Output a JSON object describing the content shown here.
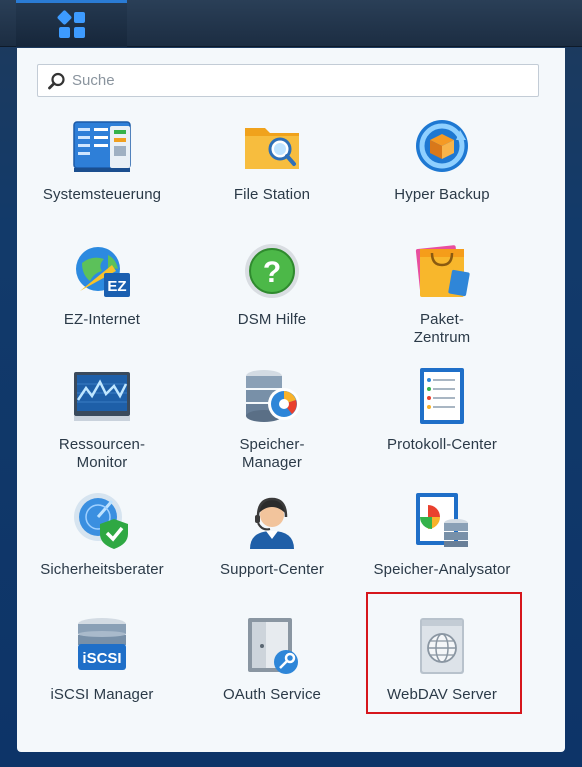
{
  "search": {
    "placeholder": "Suche"
  },
  "apps": [
    {
      "label": "Systemsteuerung",
      "icon": "control-panel-icon"
    },
    {
      "label": "File Station",
      "icon": "folder-search-icon"
    },
    {
      "label": "Hyper Backup",
      "icon": "hyper-backup-icon"
    },
    {
      "label": "EZ-Internet",
      "icon": "globe-ez-icon"
    },
    {
      "label": "DSM Hilfe",
      "icon": "help-icon"
    },
    {
      "label": "Paket-\nZentrum",
      "icon": "package-bag-icon"
    },
    {
      "label": "Ressourcen-\nMonitor",
      "icon": "monitor-graph-icon"
    },
    {
      "label": "Speicher-\nManager",
      "icon": "storage-manager-icon"
    },
    {
      "label": "Protokoll-Center",
      "icon": "log-center-icon"
    },
    {
      "label": "Sicherheitsberater",
      "icon": "security-shield-icon"
    },
    {
      "label": "Support-Center",
      "icon": "support-agent-icon"
    },
    {
      "label": "Speicher-Analysator",
      "icon": "storage-analyzer-icon"
    },
    {
      "label": "iSCSI Manager",
      "icon": "iscsi-icon"
    },
    {
      "label": "OAuth Service",
      "icon": "oauth-key-icon"
    },
    {
      "label": "WebDAV Server",
      "icon": "webdav-globe-icon"
    }
  ],
  "colors": {
    "accent": "#2a7bd4",
    "highlight": "#d6161c",
    "panel": "#f4f8fb"
  }
}
